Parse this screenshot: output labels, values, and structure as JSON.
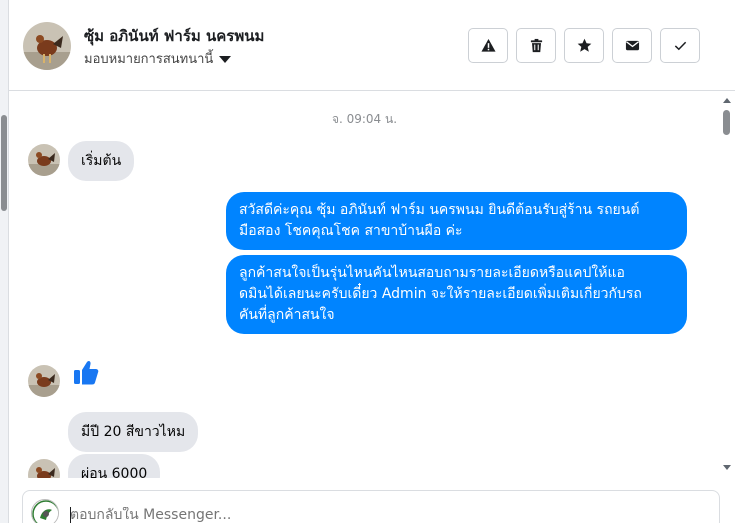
{
  "header": {
    "title": "ซุ้ม อภินันท์ ฟาร์ม นครพนม",
    "assign_label": "มอบหมายการสนทนานี้",
    "actions": [
      {
        "name": "report-button",
        "icon": "warning-icon"
      },
      {
        "name": "delete-button",
        "icon": "trash-icon"
      },
      {
        "name": "star-button",
        "icon": "star-icon"
      },
      {
        "name": "mark-unread-button",
        "icon": "envelope-icon"
      },
      {
        "name": "mark-done-button",
        "icon": "checkmark-icon"
      }
    ]
  },
  "chat": {
    "timestamp": "จ. 09:04 น.",
    "messages": [
      {
        "from": "customer",
        "text": "เริ่มต้น"
      },
      {
        "from": "page",
        "lines": [
          "สวัสดีค่ะคุณ ซุ้ม อภินันท์ ฟาร์ม นครพนม ยินดีต้อนรับสู่ร้าน รถยนต์",
          "มือสอง โชคคุณโชค สาขาบ้านผือ ค่ะ"
        ]
      },
      {
        "from": "page",
        "lines": [
          "ลูกค้าสนใจเป็นรุ่นไหนคันไหนสอบถามรายละเอียดหรือแคปให้แอ",
          "ดมินได้เลยนะครับเดี๋ยว Admin จะให้รายละเอียดเพิ่มเติมเกี่ยวกับรถ",
          "คันที่ลูกค้าสนใจ"
        ]
      },
      {
        "from": "customer",
        "type": "like",
        "icon": "thumbs-up-icon"
      },
      {
        "from": "customer",
        "text": "มีปี 20 สีขาวไหม"
      },
      {
        "from": "customer",
        "text": "ผ่อน 6000"
      }
    ]
  },
  "composer": {
    "placeholder": "ตอบกลับใน Messenger..."
  },
  "colors": {
    "outgoing_bubble": "#0084ff",
    "incoming_bubble": "#e4e6eb",
    "like_icon": "#1877f2"
  }
}
